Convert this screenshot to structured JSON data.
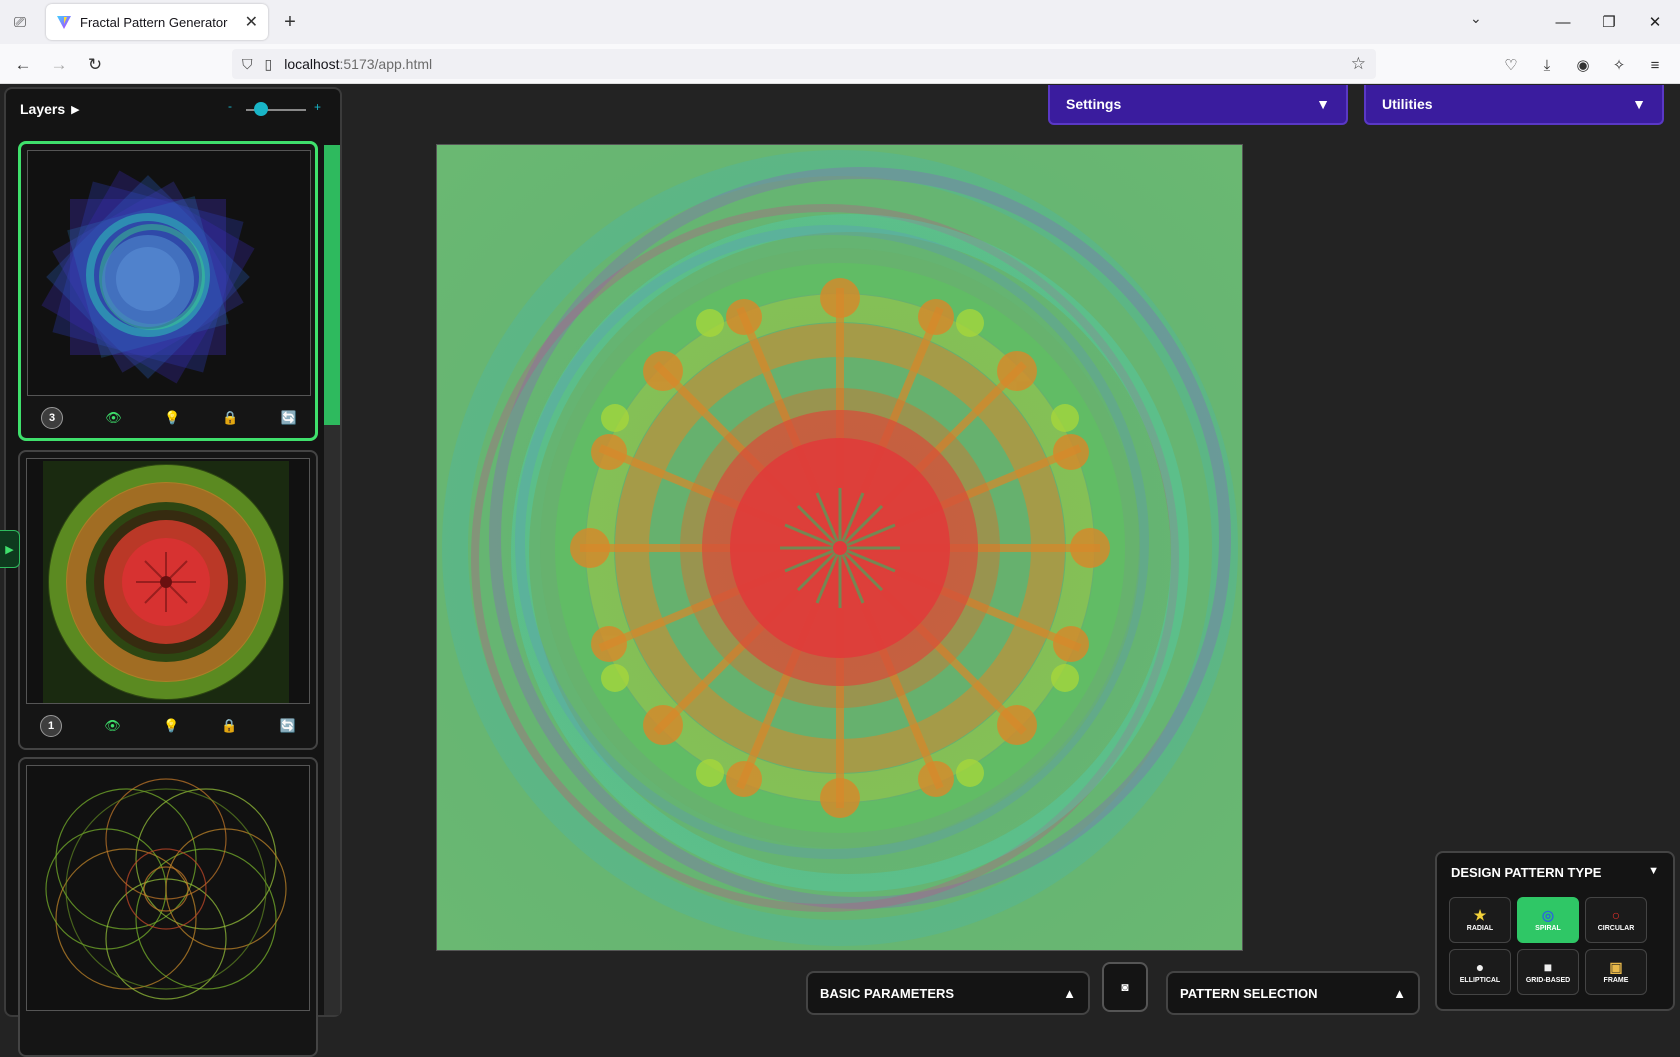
{
  "browser": {
    "tab_title": "Fractal Pattern Generator",
    "tab_close": "✕",
    "new_tab": "+",
    "url_host": "localhost",
    "url_rest": ":5173/app.html",
    "icons": {
      "tab_list": "tab-list-icon",
      "back": "back-arrow-icon",
      "forward": "forward-arrow-icon",
      "reload": "reload-icon",
      "shield": "shield-icon",
      "page": "page-icon",
      "bookmark": "star-icon",
      "pocket": "pocket-icon",
      "downloads": "download-icon",
      "account": "account-icon",
      "extensions": "extensions-icon",
      "menu": "hamburger-menu-icon"
    }
  },
  "layers": {
    "title": "Layers",
    "zoom_minus": "-",
    "zoom_plus": "+",
    "zoom_level": 0.25,
    "items": [
      {
        "number": "3",
        "active": true
      },
      {
        "number": "1",
        "active": false
      },
      {
        "number": "",
        "active": false
      }
    ]
  },
  "header": {
    "settings_label": "Settings",
    "utilities_label": "Utilities",
    "caret_down": "▼"
  },
  "design_pattern": {
    "title": "DESIGN PATTERN TYPE",
    "options": [
      {
        "label": "RADIAL",
        "icon": "★",
        "active": false
      },
      {
        "label": "SPIRAL",
        "icon": "🌀",
        "active": true
      },
      {
        "label": "CIRCULAR",
        "icon": "○",
        "active": false
      },
      {
        "label": "ELLIPTICAL",
        "icon": "●",
        "active": false
      },
      {
        "label": "GRID-BASED",
        "icon": "■",
        "active": false
      },
      {
        "label": "FRAME",
        "icon": "▣",
        "active": false
      }
    ]
  },
  "bottom": {
    "basic_parameters": "BASIC PARAMETERS",
    "pattern_selection": "PATTERN SELECTION",
    "caret_up": "▲",
    "center_button_icon": "◙"
  },
  "colors": {
    "accent_green": "#3fe06c",
    "purple": "#3a1c9e",
    "teal": "#19b5c7"
  }
}
